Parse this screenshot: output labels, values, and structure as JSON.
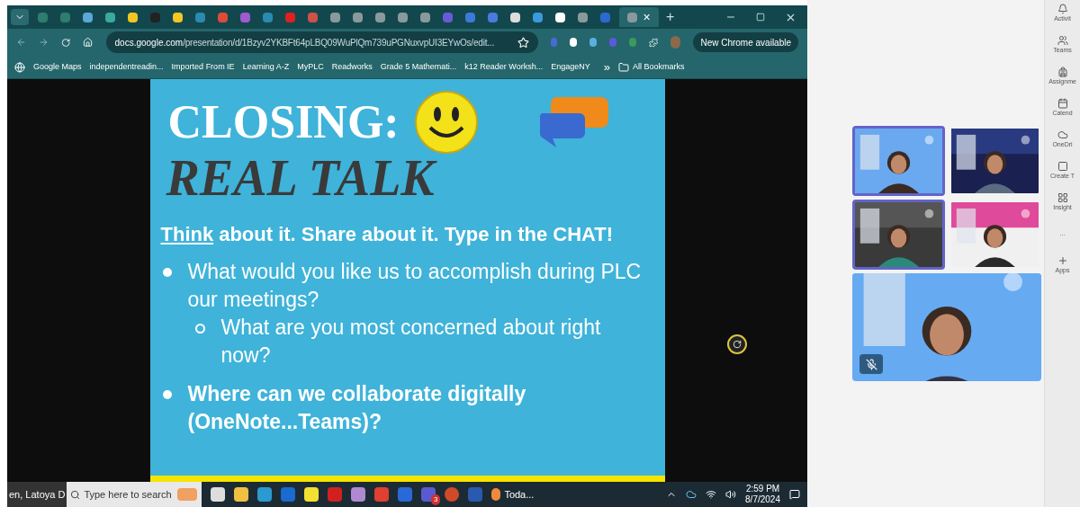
{
  "browser": {
    "tabs": [
      {
        "color": "#2e7d6e",
        "selected": false
      },
      {
        "color": "#2e7d6e",
        "selected": false
      },
      {
        "color": "#5aa8d8",
        "selected": false
      },
      {
        "color": "#3aa9a0",
        "selected": false
      },
      {
        "color": "#f3c623",
        "selected": false
      },
      {
        "color": "#222222",
        "selected": false
      },
      {
        "color": "#f3c623",
        "selected": false
      },
      {
        "color": "#2a8ab0",
        "selected": false
      },
      {
        "color": "#e04a3a",
        "selected": false
      },
      {
        "color": "#a05ad0",
        "selected": false
      },
      {
        "color": "#2a8ab0",
        "selected": false
      },
      {
        "color": "#e02020",
        "selected": false
      },
      {
        "color": "#d0504a",
        "selected": false
      },
      {
        "color": "#8a9a9c",
        "selected": false
      },
      {
        "color": "#8a9a9c",
        "selected": false
      },
      {
        "color": "#8a9a9c",
        "selected": false
      },
      {
        "color": "#8a9a9c",
        "selected": false
      },
      {
        "color": "#8a9a9c",
        "selected": false
      },
      {
        "color": "#6a5ad8",
        "selected": false
      },
      {
        "color": "#3a7ad8",
        "selected": false
      },
      {
        "color": "#4a7ae0",
        "selected": false
      },
      {
        "color": "#dddddd",
        "selected": false
      },
      {
        "color": "#3a9ae0",
        "selected": false
      },
      {
        "color": "#ffffff",
        "selected": false
      },
      {
        "color": "#8a9a9c",
        "selected": false
      },
      {
        "color": "#2a6ad0",
        "selected": false
      },
      {
        "color": "#8a9a9c",
        "selected": true
      }
    ],
    "close_tab": "×",
    "new_tab": "+",
    "url_host": "docs.google.com",
    "url_path": "/presentation/d/1Bzyv2YKBFt64pLBQ09WuPlQm739uPGNuxvpUI3EYwOs/edit...",
    "update_button": "New Chrome available",
    "bookmarks": [
      "Google Maps",
      "independentreadin...",
      "Imported From IE",
      "Learning A-Z",
      "MyPLC",
      "Readworks",
      "Grade 5 Mathemati...",
      "k12 Reader Worksh...",
      "EngageNY"
    ],
    "more_bookmarks": "»",
    "all_bookmarks": "All Bookmarks"
  },
  "slide": {
    "title": "CLOSING:",
    "subtitle": "REAL TALK",
    "prompt_lead": "Think",
    "prompt_rest": "about it. Share about it. Type in the CHAT!",
    "bullets": [
      {
        "text": "What would you like us to accomplish during PLC our meetings?",
        "bold": false,
        "children": [
          {
            "text": "What are you most concerned about right now?",
            "bold": false
          }
        ]
      },
      {
        "text": "Where can we collaborate digitally (OneNote...Teams)?",
        "bold": true
      }
    ]
  },
  "taskbar": {
    "presenter": "en, Latoya D",
    "search": {
      "placeholder": "Type here to search"
    },
    "teams_badge": "3",
    "weather": "Toda...",
    "time": "2:59 PM",
    "date": "8/7/2024"
  },
  "participants": [
    {
      "speaking": true
    },
    {
      "speaking": false
    },
    {
      "speaking": true
    },
    {
      "speaking": false
    }
  ],
  "featured": {
    "muted": true
  },
  "app_rail": [
    "Activit",
    "Teams",
    "Assignme",
    "Calend",
    "OneDri",
    "Create T",
    "Insight",
    "...",
    "Apps"
  ]
}
